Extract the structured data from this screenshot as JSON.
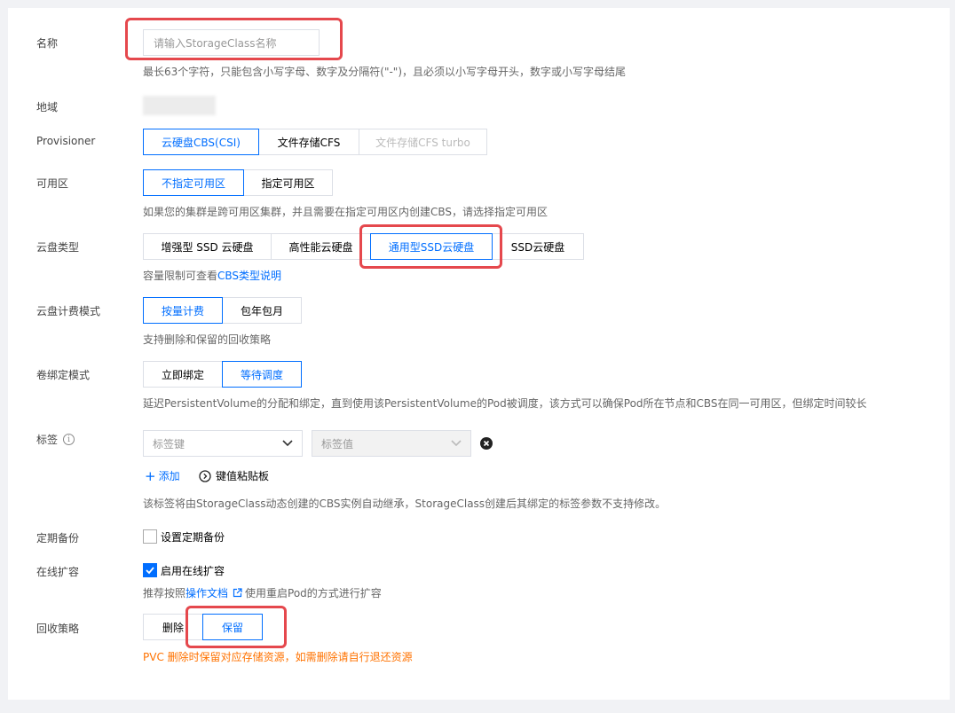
{
  "name": {
    "label": "名称",
    "placeholder": "请输入StorageClass名称",
    "help": "最长63个字符，只能包含小写字母、数字及分隔符(\"-\")，且必须以小写字母开头，数字或小写字母结尾"
  },
  "region": {
    "label": "地域"
  },
  "provisioner": {
    "label": "Provisioner",
    "options": [
      "云硬盘CBS(CSI)",
      "文件存储CFS",
      "文件存储CFS turbo"
    ]
  },
  "zone": {
    "label": "可用区",
    "options": [
      "不指定可用区",
      "指定可用区"
    ],
    "help": "如果您的集群是跨可用区集群，并且需要在指定可用区内创建CBS，请选择指定可用区"
  },
  "disk_type": {
    "label": "云盘类型",
    "options": [
      "增强型 SSD 云硬盘",
      "高性能云硬盘",
      "通用型SSD云硬盘",
      "SSD云硬盘"
    ],
    "help_prefix": "容量限制可查看",
    "help_link": "CBS类型说明"
  },
  "billing": {
    "label": "云盘计费模式",
    "options": [
      "按量计费",
      "包年包月"
    ],
    "help": "支持删除和保留的回收策略"
  },
  "binding": {
    "label": "卷绑定模式",
    "options": [
      "立即绑定",
      "等待调度"
    ],
    "help": "延迟PersistentVolume的分配和绑定，直到使用该PersistentVolume的Pod被调度，该方式可以确保Pod所在节点和CBS在同一可用区，但绑定时间较长"
  },
  "tags": {
    "label": "标签",
    "key_placeholder": "标签键",
    "value_placeholder": "标签值",
    "add_label": "添加",
    "paste_label": "键值粘贴板",
    "help": "该标签将由StorageClass动态创建的CBS实例自动继承，StorageClass创建后其绑定的标签参数不支持修改。"
  },
  "backup": {
    "label": "定期备份",
    "checkbox_label": "设置定期备份"
  },
  "expand": {
    "label": "在线扩容",
    "checkbox_label": "启用在线扩容",
    "help_prefix": "推荐按照",
    "help_link": "操作文档",
    "help_suffix": "使用重启Pod的方式进行扩容"
  },
  "reclaim": {
    "label": "回收策略",
    "options": [
      "删除",
      "保留"
    ],
    "warning": "PVC 删除时保留对应存储资源，如需删除请自行退还资源"
  },
  "colors": {
    "accent": "#006eff",
    "highlight_box": "#e5484d",
    "warning": "#ff7200"
  }
}
